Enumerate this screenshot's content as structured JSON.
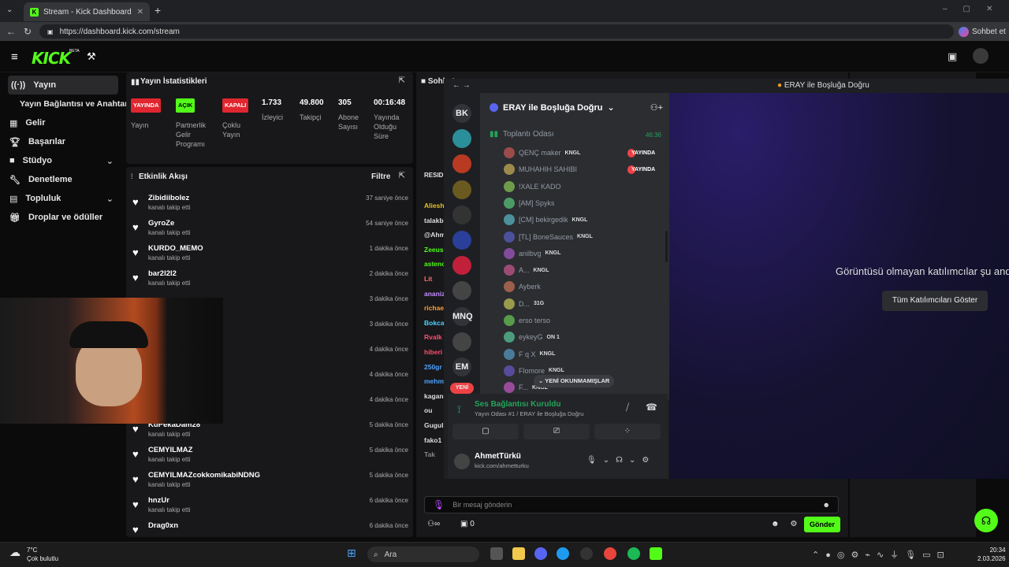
{
  "browser": {
    "tab_title": "Stream - Kick Dashboard",
    "url": "https://dashboard.kick.com/stream",
    "copilot": "Sohbet et"
  },
  "kick": {
    "logo": "KICK",
    "beta": "BETA"
  },
  "sidebar": {
    "items": [
      {
        "label": "Yayın",
        "icon": "broadcast-icon"
      },
      {
        "label": "Yayın Bağlantısı ve Anahtarı",
        "icon": ""
      },
      {
        "label": "Gelir",
        "icon": "dashboard-icon"
      },
      {
        "label": "Başarılar",
        "icon": "trophy-icon"
      },
      {
        "label": "Stüdyo",
        "icon": "video-icon"
      },
      {
        "label": "Denetleme",
        "icon": "wrench-icon"
      },
      {
        "label": "Topluluk",
        "icon": "community-icon"
      },
      {
        "label": "Droplar ve ödüller",
        "icon": "gift-icon"
      }
    ]
  },
  "stats": {
    "title": "Yayın İstatistikleri",
    "cols": [
      {
        "badge": "YAYINDA",
        "label": "Yayın"
      },
      {
        "badge": "AÇIK",
        "label": "Partnerlik Gelir Programı"
      },
      {
        "badge": "KAPALI",
        "label": "Çoklu Yayın"
      },
      {
        "value": "1.733",
        "label": "İzleyici"
      },
      {
        "value": "49.800",
        "label": "Takipçi"
      },
      {
        "value": "305",
        "label": "Abone Sayısı"
      },
      {
        "value": "00:16:48",
        "label": "Yayında Olduğu Süre"
      }
    ]
  },
  "activity": {
    "title": "Etkinlik Akışı",
    "filter": "Filtre",
    "items": [
      {
        "name": "Zibidiibolez",
        "action": "kanalı takip etti",
        "time": "37 saniye önce"
      },
      {
        "name": "GyroZe",
        "action": "kanalı takip etti",
        "time": "54 saniye önce"
      },
      {
        "name": "KURDO_MEMO",
        "action": "kanalı takip etti",
        "time": "1 dakika önce"
      },
      {
        "name": "bar2l2l2",
        "action": "kanalı takip etti",
        "time": "2 dakika önce"
      },
      {
        "name": "",
        "action": "",
        "time": "3 dakika önce"
      },
      {
        "name": "",
        "action": "",
        "time": "3 dakika önce"
      },
      {
        "name": "",
        "action": "",
        "time": "4 dakika önce"
      },
      {
        "name": "",
        "action": "",
        "time": "4 dakika önce"
      },
      {
        "name": "",
        "action": "",
        "time": "4 dakika önce"
      },
      {
        "name": "KuPekaDam28",
        "action": "kanalı takip etti",
        "time": "5 dakika önce"
      },
      {
        "name": "CEMYILMAZ",
        "action": "kanalı takip etti",
        "time": "5 dakika önce"
      },
      {
        "name": "CEMYILMAZcokkomikabiNDNG",
        "action": "kanalı takip etti",
        "time": "5 dakika önce"
      },
      {
        "name": "hnzUr",
        "action": "kanalı takip etti",
        "time": "6 dakika önce"
      },
      {
        "name": "Drag0xn",
        "action": "",
        "time": "6 dakika önce"
      }
    ]
  },
  "chat": {
    "title": "Sohbet",
    "resid": "RESID",
    "names": [
      {
        "t": "Aliesh",
        "c": "#e6c31e"
      },
      {
        "t": "talakb",
        "c": "#ddd"
      },
      {
        "t": "@Ahm",
        "c": "#ddd"
      },
      {
        "t": "Zeeus",
        "c": "#53fc18"
      },
      {
        "t": "astenc",
        "c": "#53fc18"
      },
      {
        "t": "Lit",
        "c": "#ff6b6b"
      },
      {
        "t": "ananiz",
        "c": "#c48bff"
      },
      {
        "t": "richae",
        "c": "#ff9d2e"
      },
      {
        "t": "Bokca",
        "c": "#4dd3ff"
      },
      {
        "t": "Rvalk",
        "c": "#ff4d6d"
      },
      {
        "t": "hiberi",
        "c": "#ff4d6d"
      },
      {
        "t": "250gr",
        "c": "#4da3ff"
      },
      {
        "t": "mehm",
        "c": "#4da3ff"
      },
      {
        "t": "kagan",
        "c": "#ddd"
      },
      {
        "t": "ou",
        "c": "#ddd"
      },
      {
        "t": "Gugul",
        "c": "#ddd"
      },
      {
        "t": "fako1",
        "c": "#ddd"
      },
      {
        "t": "Tak",
        "c": "#888"
      }
    ],
    "placeholder": "Bir mesaj gönderin",
    "count": "0",
    "send": "Gönder"
  },
  "discord": {
    "window_title": "ERAY ile Boşluğa Doğru",
    "server_name": "ERAY ile Boşluğa Doğru",
    "channel": "Toplantı Odası",
    "channel_time": "46:36",
    "servers": [
      "BK",
      "",
      "",
      "",
      "",
      "",
      "",
      "",
      "MNQ",
      "",
      "EM",
      "YENİ"
    ],
    "members": [
      {
        "name": "QENÇ maker",
        "tag": "KNGL",
        "live": "YAYINDA"
      },
      {
        "name": "MUHAHIH SAHIBI",
        "tag": "",
        "live": "YAYINDA"
      },
      {
        "name": "!XALE KADO",
        "tag": "",
        "live": ""
      },
      {
        "name": "[AM] Spyks",
        "tag": "",
        "live": ""
      },
      {
        "name": "[CM] bekirgedik",
        "tag": "KNGL",
        "live": ""
      },
      {
        "name": "[TL] BoneSauces",
        "tag": "KNGL",
        "live": ""
      },
      {
        "name": "anilbvg",
        "tag": "KNGL",
        "live": ""
      },
      {
        "name": "A...",
        "tag": "KNGL",
        "live": ""
      },
      {
        "name": "Ayberk",
        "tag": "",
        "live": ""
      },
      {
        "name": "D...",
        "tag": "31G",
        "live": ""
      },
      {
        "name": "erso terso",
        "tag": "",
        "live": ""
      },
      {
        "name": "eykeyG",
        "tag": "ON 1",
        "live": ""
      },
      {
        "name": "F q X",
        "tag": "KNGL",
        "live": ""
      },
      {
        "name": "Flomore",
        "tag": "KNGL",
        "live": ""
      },
      {
        "name": "F...",
        "tag": "KNGL",
        "live": ""
      }
    ],
    "unread": "YENİ OKUNMAMIŞLAR",
    "voice_status": "Ses Bağlantısı Kuruldu",
    "voice_sub": "Yayın Odası #1 / ERAY ile Boşluğa Doğru",
    "user_name": "AhmetTürkü",
    "user_sub": "kick.com/ahmetturku",
    "stage_text": "Görüntüsü olmayan katılımcılar şu anda",
    "stage_button": "Tüm Katılımcıları Göster"
  },
  "taskbar": {
    "temp": "7°C",
    "weather": "Çok bulutlu",
    "search": "Ara",
    "time": "20:34",
    "date": "2.03.2026"
  },
  "colors": {
    "kick_green": "#53fc18",
    "live_red": "#ed4245",
    "discord_bg": "#2b2d31"
  }
}
